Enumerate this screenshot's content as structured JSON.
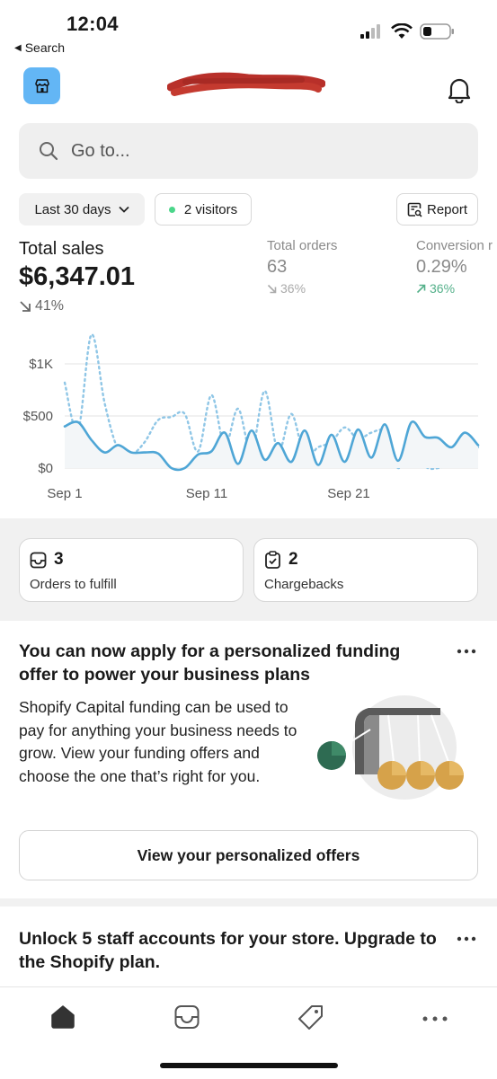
{
  "status_bar": {
    "time": "12:04",
    "back_label": "Search"
  },
  "header": {
    "store_icon": "store-icon",
    "bell_icon": "bell-icon"
  },
  "search": {
    "placeholder": "Go to..."
  },
  "filters": {
    "date_range": "Last 30 days",
    "visitors": "2 visitors",
    "report": "Report"
  },
  "metrics": {
    "total_sales": {
      "label": "Total sales",
      "value": "$6,347.01",
      "change": "41%"
    },
    "total_orders": {
      "label": "Total orders",
      "value": "63",
      "change": "36%"
    },
    "conversion": {
      "label": "Conversion r",
      "value": "0.29%",
      "change": "36%"
    }
  },
  "chart_data": {
    "type": "line",
    "yticks": [
      "$1K",
      "$500",
      "$0"
    ],
    "xticks": [
      "Sep 1",
      "Sep 11",
      "Sep 21"
    ],
    "ylim": [
      0,
      1000
    ],
    "series": [
      {
        "style": "solid",
        "color": "#4fa6d6",
        "values": [
          400,
          440,
          270,
          150,
          220,
          150,
          150,
          140,
          0,
          0,
          130,
          160,
          340,
          40,
          360,
          80,
          240,
          60,
          360,
          30,
          320,
          60,
          370,
          100,
          420,
          70,
          440,
          300,
          290,
          200,
          340,
          220
        ]
      },
      {
        "style": "dotted",
        "color": "#8fc6e6",
        "values": [
          820,
          360,
          1280,
          620,
          180,
          130,
          250,
          460,
          490,
          520,
          160,
          700,
          210,
          570,
          150,
          740,
          160,
          520,
          110,
          200,
          250,
          390,
          280,
          340,
          340,
          0,
          240,
          20,
          0,
          60,
          190,
          200
        ]
      }
    ],
    "grid": true
  },
  "tasks": [
    {
      "count": "3",
      "label": "Orders to fulfill",
      "icon": "inbox-icon"
    },
    {
      "count": "2",
      "label": "Chargebacks",
      "icon": "clipboard-check-icon"
    }
  ],
  "funding_card": {
    "title": "You can now apply for a personalized funding offer to power your business plans",
    "body": "Shopify Capital funding can be used to pay for anything your business needs to grow. View your funding offers and choose the one that’s right for you.",
    "button": "View your personalized offers",
    "more_icon": "ellipsis-icon"
  },
  "staff_card": {
    "title": "Unlock 5 staff accounts for your store. Upgrade to the Shopify plan.",
    "more_icon": "ellipsis-icon"
  },
  "tab_bar": [
    "home-icon",
    "inbox-icon",
    "tag-icon",
    "more-icon"
  ]
}
